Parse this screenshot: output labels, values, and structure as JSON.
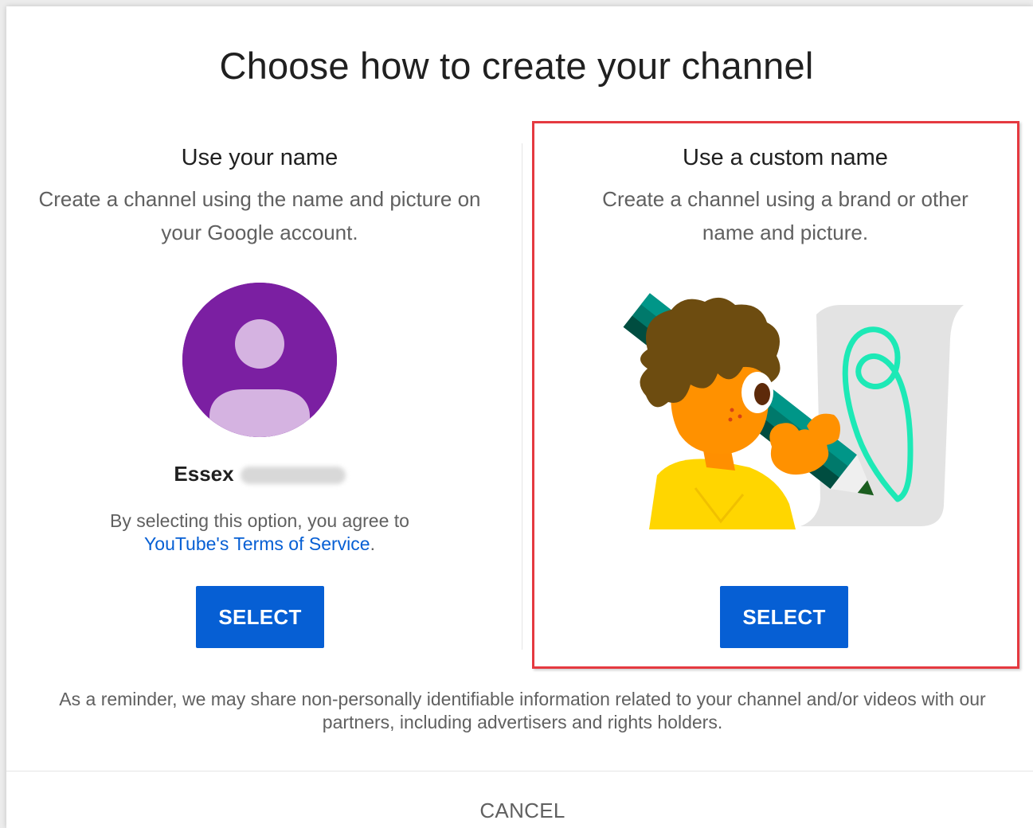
{
  "dialog": {
    "title": "Choose how to create your channel",
    "reminder": "As a reminder, we may share non-personally identifiable information related to your channel and/or videos with our partners, including advertisers and rights holders.",
    "cancel_label": "CANCEL"
  },
  "option_own_name": {
    "heading": "Use your name",
    "description": "Create a channel using the name and picture on your Google account.",
    "account_name_first": "Essex",
    "terms_prefix": "By selecting this option, you agree to",
    "terms_link": "YouTube's Terms of Service",
    "terms_suffix": ".",
    "select_label": "SELECT",
    "avatar_icon": "person-avatar-icon"
  },
  "option_custom_name": {
    "heading": "Use a custom name",
    "description": "Create a channel using a brand or other name and picture.",
    "select_label": "SELECT",
    "illustration": "person-drawing-with-pencil-illustration"
  },
  "colors": {
    "primary_button": "#065fd4",
    "link": "#065fd4",
    "highlight_border": "#e53940",
    "avatar_bg": "#7b1fa2",
    "avatar_fg": "#d5b3e1"
  }
}
